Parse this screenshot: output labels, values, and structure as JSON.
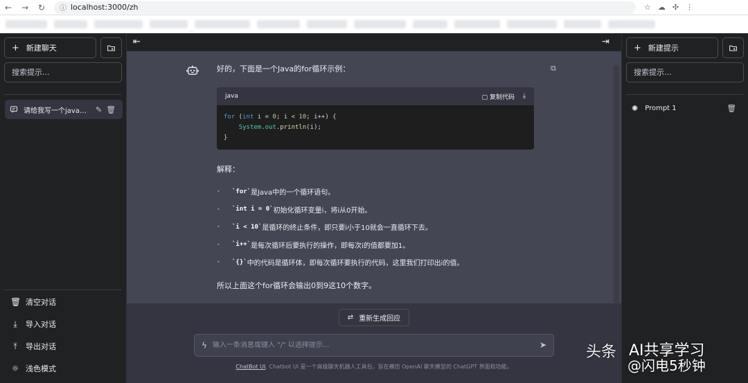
{
  "browser": {
    "url": "localhost:3000/zh"
  },
  "left_sidebar": {
    "new_chat": "新建聊天",
    "search_placeholder": "搜索提示...",
    "conversations": [
      {
        "label": "请给我写一个java的for..."
      }
    ],
    "bottom": [
      {
        "label": "清空对话",
        "icon": "trash-icon"
      },
      {
        "label": "导入对话",
        "icon": "import-icon"
      },
      {
        "label": "导出对话",
        "icon": "export-icon"
      },
      {
        "label": "浅色模式",
        "icon": "sun-icon"
      }
    ]
  },
  "chat": {
    "intro": "好的，下面是一个Java的for循环示例：",
    "code": {
      "lang": "java",
      "copy_label": "复制代码",
      "lines": [
        "for (int i = 0; i < 10; i++) {",
        "    System.out.println(i);",
        "}"
      ]
    },
    "explain_title": "解释：",
    "bullets": [
      {
        "code": "`for`",
        "text": "是Java中的一个循环语句。"
      },
      {
        "code": "`int i = 0`",
        "text": "初始化循环变量i，将i从0开始。"
      },
      {
        "code": "`i < 10`",
        "text": "是循环的终止条件，即只要i小于10就会一直循环下去。"
      },
      {
        "code": "`i++`",
        "text": "是每次循环后要执行的操作，即每次i的值都要加1。"
      },
      {
        "code": "`{}`",
        "text": "中的代码是循环体，即每次循环要执行的代码，这里我们打印出i的值。"
      }
    ],
    "summary": "所以上面这个for循环会输出0到9这10个数字。",
    "regenerate": "重新生成回应",
    "input_placeholder": "输入一条消息或键入 \"/\" 以选择提示...",
    "footer_link": "ChatBot UI",
    "footer_text": ". Chatbot UI 是一个高级聊天机器人工具包，旨在模仿 OpenAI 聊天模型的 ChatGPT 界面和功能。"
  },
  "right_sidebar": {
    "new_prompt": "新建提示",
    "search_placeholder": "搜索提示...",
    "prompts": [
      {
        "label": "Prompt 1"
      }
    ]
  },
  "watermark": {
    "line1": "头条",
    "line2": "AI共享学习",
    "line3": "@闪电5秒钟"
  }
}
